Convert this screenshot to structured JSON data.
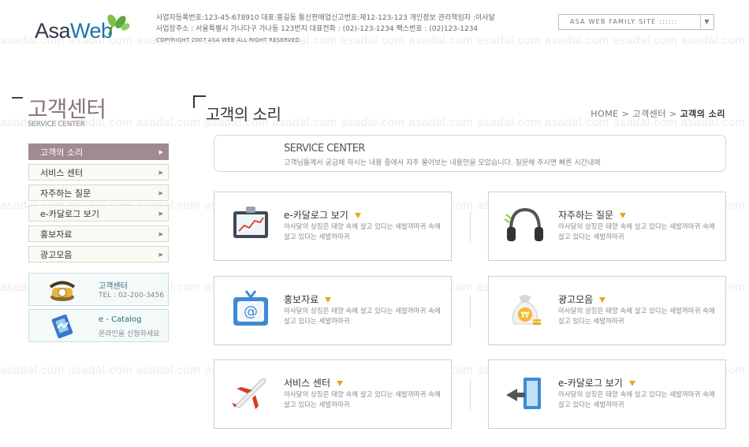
{
  "watermark": {
    "text": "asadal.com"
  },
  "header": {
    "logo": {
      "main": "Asa",
      "accent": "Web"
    },
    "company_lines": [
      "사업자등록번호:123-45-678910 대표:홍길동 통신판매업신고번호:제12-123-123 개인정보 관리책임자 :이사달",
      "사업장주소 : 서울특별시 가나다구 가나동 123번지 대표전화 : (02)-123-1234 팩스번호 : (02)123-1234",
      "COPYRIGHT 2007 ASA WEB ALL RIGHT RESERVED."
    ],
    "family_site": {
      "selected": "ASA WEB FAMILY SITE ::::::"
    }
  },
  "sidebar": {
    "title_ko": "고객센터",
    "title_en": "SERVICE CENTER",
    "items": [
      {
        "label": "고객의 소리",
        "active": true
      },
      {
        "label": "서비스 센터",
        "active": false
      },
      {
        "label": "자주하는 질문",
        "active": false
      },
      {
        "label": "e-카달로그 보기",
        "active": false
      },
      {
        "label": "홍보자료",
        "active": false
      },
      {
        "label": "광고모음",
        "active": false
      }
    ],
    "banners": [
      {
        "title": "고객센터",
        "sub": "TEL : 02-200-3456",
        "icon": "telephone-icon"
      },
      {
        "title": "e - Catalog",
        "sub": "온라인을 신청하세요",
        "icon": "catalog-icon"
      }
    ]
  },
  "main": {
    "title": "고객의 소리",
    "breadcrumb": [
      "HOME",
      ">",
      "고객센터",
      ">",
      "고객의 소리"
    ],
    "service_box": {
      "heading": "SERVICE CENTER",
      "desc": "고객님들께서 궁금해 하시는 내용 중에서 자주 물어보는 내용만을 모았습니다. 질문해 주시면 빠른 시간내에"
    },
    "cards": [
      {
        "title": "e-카달로그 보기",
        "desc": "아사달의 상징은 태양 속에 살고 있다는 세발까마귀 속에 살고 있다는 세발까마귀",
        "icon": "chart-board-icon"
      },
      {
        "title": "자주하는 질문",
        "desc": "아사달의 상징은 태양 속에 살고 있다는 세발까마귀 속에 살고 있다는 세발까마귀",
        "icon": "headset-icon"
      },
      {
        "title": "홍보자료",
        "desc": "아사달의 상징은 태양 속에 살고 있다는 세발까마귀 속에 살고 있다는 세발까마귀",
        "icon": "email-monitor-icon"
      },
      {
        "title": "광고모음",
        "desc": "아사달의 상징은 태양 속에 살고 있다는 세발까마귀 속에 살고 있다는 세발까마귀",
        "icon": "money-bag-icon"
      },
      {
        "title": "서비스 센터",
        "desc": "아사달의 상징은 태양 속에 살고 있다는 세발까마귀 속에 살고 있다는 세발까마귀",
        "icon": "airplane-icon"
      },
      {
        "title": "e-카달로그 보기",
        "desc": "아사달의 상징은 태양 속에 살고 있다는 세발까마귀 속에 살고 있다는 세발까마귀",
        "icon": "door-exit-icon"
      }
    ]
  },
  "colors": {
    "active_menu": "#a28a95",
    "accent_orange": "#f0a020",
    "title_mauve": "#8b7381"
  }
}
